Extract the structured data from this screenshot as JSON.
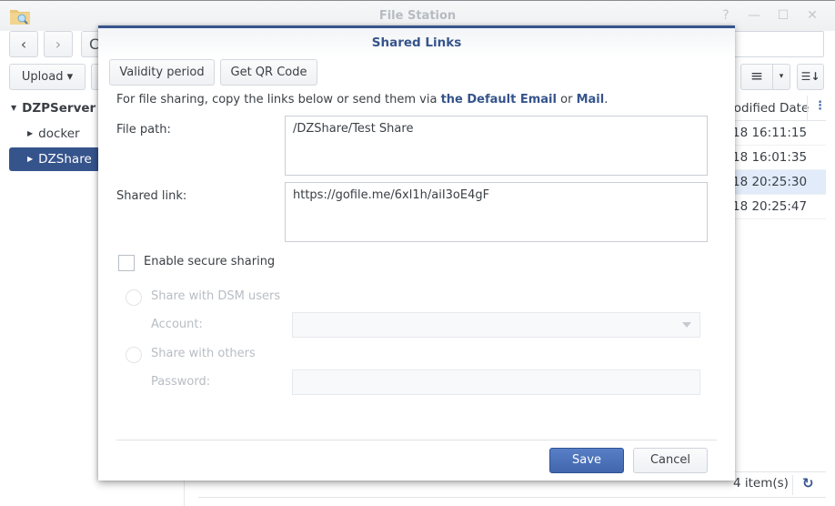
{
  "window": {
    "title": "File Station",
    "icons": [
      "file-station-icon",
      "help-icon",
      "minimize-icon",
      "maximize-icon",
      "close-icon"
    ],
    "help_glyph": "?",
    "minimize_glyph": "—",
    "maximize_glyph": "☐",
    "close_glyph": "✕"
  },
  "toolbar": {
    "back_glyph": "‹",
    "forward_glyph": "›",
    "refresh_glyph": "C",
    "upload_label": "Upload ▾",
    "view_glyph": "≡",
    "view_dropdown_glyph": "▾",
    "sort_glyph": "☰↓"
  },
  "tree": {
    "root": "DZPServer",
    "items": [
      {
        "label": "docker",
        "selected": false
      },
      {
        "label": "DZShare",
        "selected": true
      }
    ]
  },
  "grid": {
    "column_title": "Modified Date",
    "column_title_visible": "lodified Date",
    "column_menu_glyph": "⋮",
    "rows": [
      {
        "date": "18 16:11:15",
        "selected": false
      },
      {
        "date": "18 16:01:35",
        "selected": false
      },
      {
        "date": "18 20:25:30",
        "selected": true
      },
      {
        "date": "18 20:25:47",
        "selected": false
      }
    ]
  },
  "status": {
    "item_count": "4 item(s)",
    "refresh_glyph": "↻"
  },
  "dialog": {
    "title": "Shared Links",
    "validity_label": "Validity period",
    "qr_label": "Get QR Code",
    "intro_prefix": "For file sharing, copy the links below or send them via ",
    "intro_link1": "the Default Email",
    "intro_mid": " or ",
    "intro_link2": "Mail",
    "intro_suffix": ".",
    "file_path_label": "File path:",
    "file_path_value": "/DZShare/Test Share",
    "shared_link_label": "Shared link:",
    "shared_link_value": "https://gofile.me/6xl1h/aiI3oE4gF",
    "secure_label": "Enable secure sharing",
    "secure_checked": false,
    "dsm_users_label": "Share with DSM users",
    "account_label": "Account:",
    "account_value": "",
    "others_label": "Share with others",
    "password_label": "Password:",
    "password_value": "",
    "save_label": "Save",
    "cancel_label": "Cancel"
  },
  "colors": {
    "accent": "#36548c",
    "primary_button": "#4a70b8",
    "selection_row": "#e1ebf9"
  }
}
